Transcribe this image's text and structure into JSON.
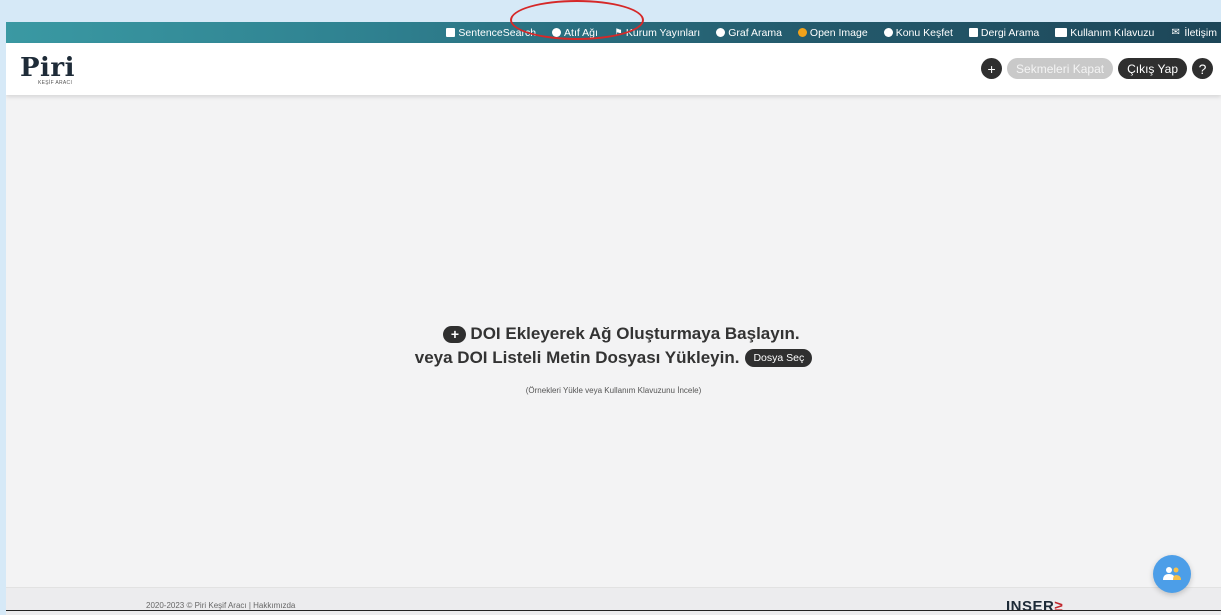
{
  "nav": {
    "items": [
      {
        "label": "SentenceSearch",
        "icon": "document-icon"
      },
      {
        "label": "Atıf Ağı",
        "icon": "network-icon"
      },
      {
        "label": "Kurum Yayınları",
        "icon": "institution-icon"
      },
      {
        "label": "Graf Arama",
        "icon": "graph-search-icon"
      },
      {
        "label": "Open Image",
        "icon": "image-icon"
      },
      {
        "label": "Konu Keşfet",
        "icon": "globe-icon"
      },
      {
        "label": "Dergi Arama",
        "icon": "book-icon"
      },
      {
        "label": "Kullanım Kılavuzu",
        "icon": "id-card-icon"
      },
      {
        "label": "İletişim",
        "icon": "mail-icon"
      }
    ]
  },
  "header": {
    "logo": "Piri",
    "logo_sub": "KEŞİF ARACI",
    "add_label": "+",
    "close_tabs_label": "Sekmeleri Kapat",
    "logout_label": "Çıkış Yap",
    "help_label": "?"
  },
  "main": {
    "line1": "DOI Ekleyerek Ağ Oluşturmaya Başlayın.",
    "line1_plus": "+",
    "line2": "veya DOI Listeli Metin Dosyası Yükleyin.",
    "file_button": "Dosya Seç",
    "hint": "(Örnekleri Yükle veya Kullanım Klavuzunu İncele)"
  },
  "footer": {
    "text": "2020-2023 © Piri Keşif Aracı | Hakkımızda",
    "logo_main": "INSER",
    "logo_accent": "≥"
  },
  "colors": {
    "nav_start": "#3a99a3",
    "nav_end": "#1d4658",
    "dark_button": "#2f2f2f",
    "fab": "#4c9ee8",
    "annotation": "#d62828"
  }
}
